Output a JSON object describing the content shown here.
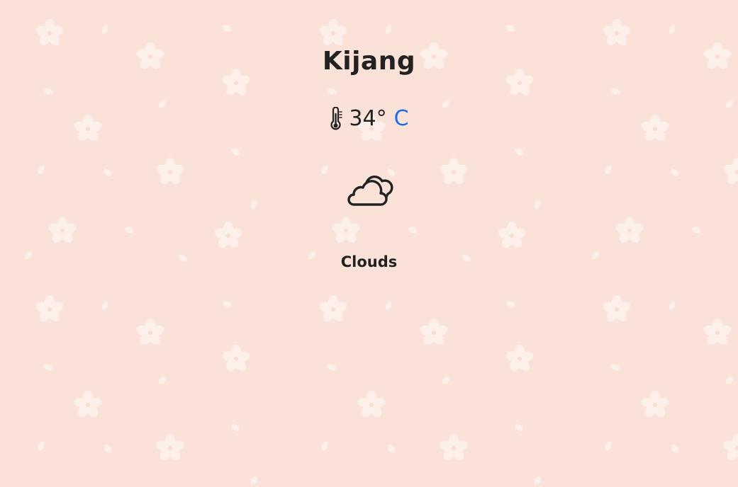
{
  "weather": {
    "city": "Kijang",
    "temperature": "34°",
    "unit": "C",
    "condition": "Clouds"
  },
  "icons": {
    "temperature": "thermometer-icon",
    "condition": "clouds-icon",
    "background": "cherry-blossom-pattern"
  },
  "colors": {
    "background": "#fbe2d9",
    "text": "#222222",
    "unit_link": "#1a6fe8",
    "pattern": "#fdf0ea"
  }
}
